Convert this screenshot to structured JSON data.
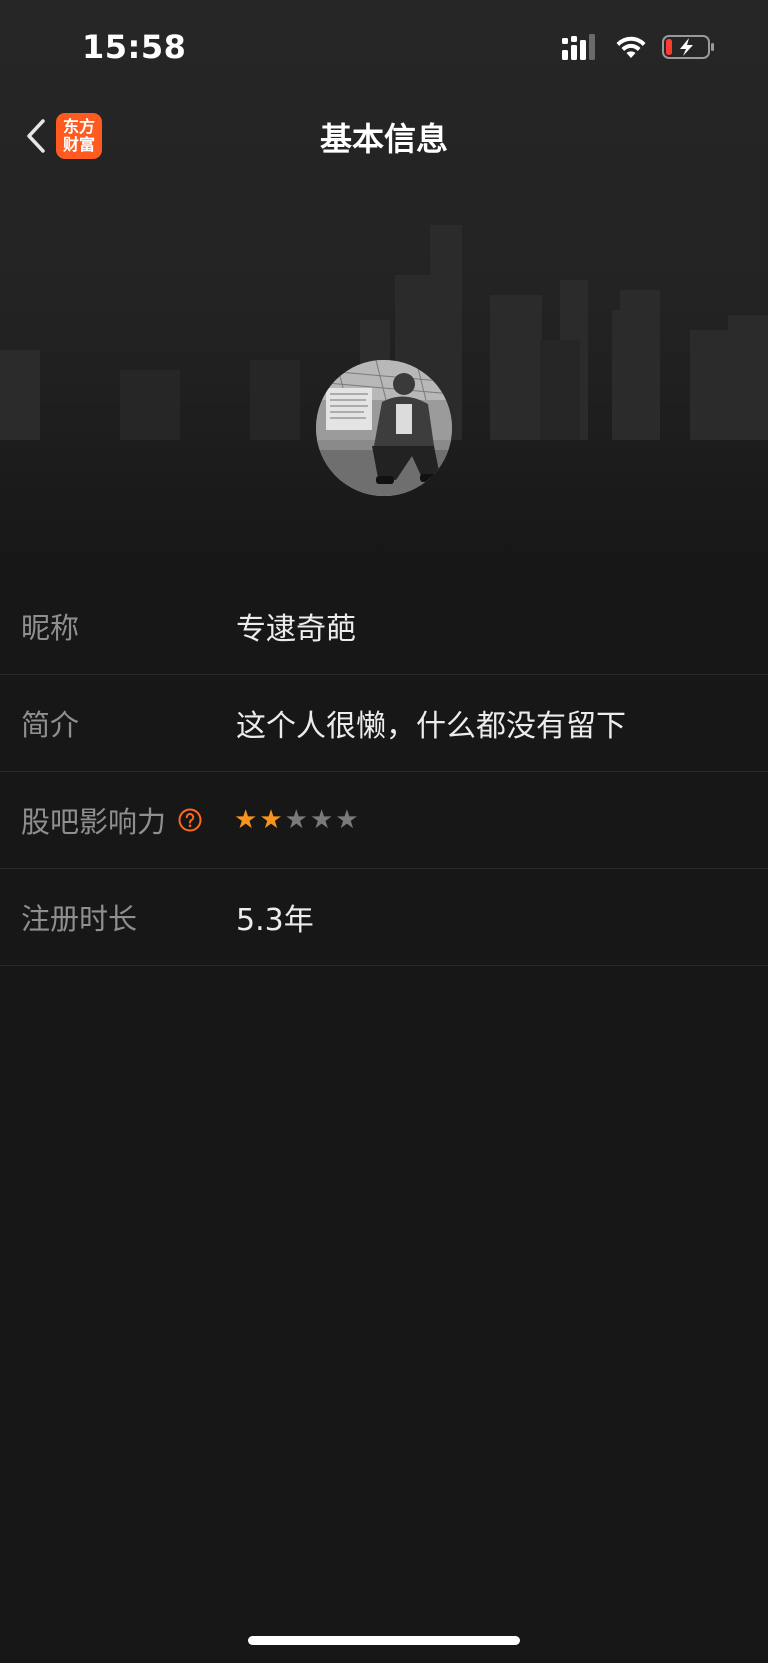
{
  "status_bar": {
    "time": "15:58",
    "battery_level": 0.12
  },
  "nav": {
    "title": "基本信息",
    "logo_lines": [
      "东方",
      "财富"
    ],
    "brand_color": "#ff5a1f"
  },
  "profile": {
    "rows": [
      {
        "label": "昵称",
        "value": "专逮奇葩"
      },
      {
        "label": "简介",
        "value": "这个人很懒，什么都没有留下"
      },
      {
        "label": "股吧影响力",
        "rating": 2,
        "rating_max": 5,
        "star_on_color": "#f7941d",
        "star_off_color": "#7a7a7a"
      },
      {
        "label": "注册时长",
        "value": "5.3年"
      }
    ]
  }
}
